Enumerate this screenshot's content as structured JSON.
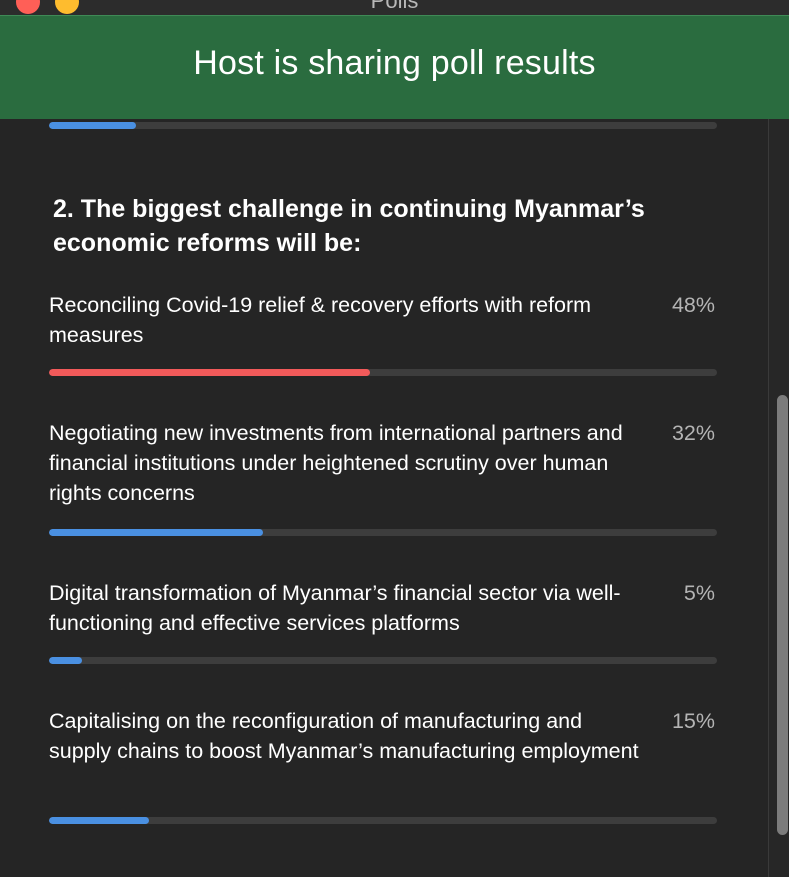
{
  "window": {
    "title": "Polls"
  },
  "banner": {
    "text": "Host is sharing poll results"
  },
  "previous_question": {
    "progress": 0.13,
    "color": "#4a90e2"
  },
  "question": {
    "text": "2. The biggest challenge in continuing Myanmar’s economic reforms will be:",
    "options": [
      {
        "label": "Reconciling Covid-19 relief & recovery efforts with reform measures",
        "percent": "48%",
        "value": 48,
        "color": "#f25a5a"
      },
      {
        "label": "Negotiating new investments from international partners and financial institutions under heightened scrutiny over human rights concerns",
        "percent": "32%",
        "value": 32,
        "color": "#4a90e2"
      },
      {
        "label": "Digital transformation of Myanmar’s financial sector via well-functioning and effective services platforms",
        "percent": "5%",
        "value": 5,
        "color": "#4a90e2"
      },
      {
        "label": "Capitalising on the reconfiguration of manufacturing and supply chains to boost Myanmar’s manufacturing employment",
        "percent": "15%",
        "value": 15,
        "color": "#4a90e2"
      }
    ]
  },
  "colors": {
    "banner": "#2a6c3f",
    "background": "#252525",
    "track": "#3d3d3d"
  }
}
